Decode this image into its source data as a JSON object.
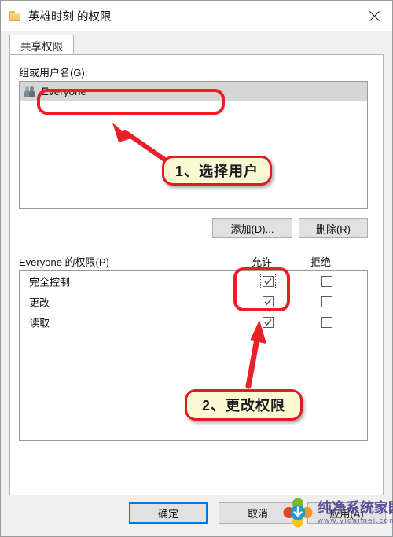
{
  "window": {
    "title": "英雄时刻 的权限",
    "folder_icon": "folder-icon",
    "close_icon": "close-icon"
  },
  "tabs": [
    {
      "label": "共享权限",
      "selected": true
    }
  ],
  "group_section": {
    "label": "组或用户名(G):",
    "entries": [
      {
        "name": "Everyone",
        "icon": "users-icon",
        "selected": true
      }
    ]
  },
  "list_buttons": {
    "add_label": "添加(D)...",
    "remove_label": "删除(R)"
  },
  "permissions_section": {
    "header_label": "Everyone 的权限(P)",
    "columns": [
      "允许",
      "拒绝"
    ],
    "rows": [
      {
        "name": "完全控制",
        "allow": true,
        "deny": false,
        "focused": true
      },
      {
        "name": "更改",
        "allow": true,
        "deny": false,
        "focused": false
      },
      {
        "name": "读取",
        "allow": true,
        "deny": false,
        "focused": false
      }
    ]
  },
  "dialog_buttons": {
    "ok_label": "确定",
    "cancel_label": "取消",
    "apply_label": "应用(A)"
  },
  "annotations": {
    "callout_1": "1、选择用户",
    "callout_2": "2、更改权限",
    "highlight_color": "#ee1c25",
    "callout_fill": "#fbf8d4"
  },
  "watermark": {
    "site_name": "纯净系统家园",
    "site_url": "www.yidaimei.com",
    "logo_icon": "download-flower-logo-icon"
  }
}
